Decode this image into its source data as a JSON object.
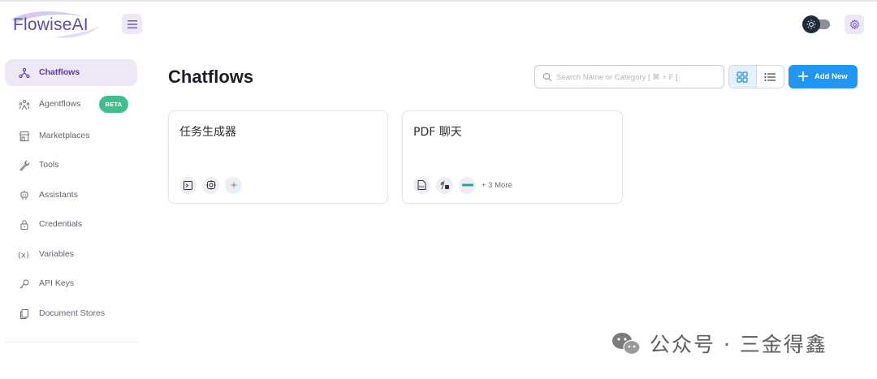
{
  "app": {
    "logo_text": "FlowiseAI"
  },
  "header": {
    "menu_icon": "menu-icon",
    "theme_icon": "sun-icon",
    "settings_icon": "gear-icon"
  },
  "sidebar": {
    "items": [
      {
        "label": "Chatflows",
        "icon": "chatflows-icon",
        "active": true
      },
      {
        "label": "Agentflows",
        "icon": "agentflows-icon",
        "badge": "BETA"
      },
      {
        "label": "Marketplaces",
        "icon": "store-icon"
      },
      {
        "label": "Tools",
        "icon": "tool-icon"
      },
      {
        "label": "Assistants",
        "icon": "robot-icon"
      },
      {
        "label": "Credentials",
        "icon": "lock-icon"
      },
      {
        "label": "Variables",
        "icon": "variable-icon"
      },
      {
        "label": "API Keys",
        "icon": "key-icon"
      },
      {
        "label": "Document Stores",
        "icon": "documents-icon"
      }
    ]
  },
  "main": {
    "title": "Chatflows",
    "search": {
      "placeholder": "Search Name or Category [ ⌘ + F ]",
      "value": ""
    },
    "add_button_label": "Add New",
    "cards": [
      {
        "title": "任务生成器",
        "node_icons": [
          "terminal-icon",
          "sparkle-chip-icon",
          "star-icon"
        ]
      },
      {
        "title": "PDF 聊天",
        "node_icons": [
          "pdf-icon",
          "ai-icon",
          "embedding-icon"
        ],
        "more": "+ 3 More"
      }
    ]
  },
  "watermark": {
    "text": "公众号 · 三金得鑫"
  },
  "colors": {
    "accent_purple": "#5e35b1",
    "primary_blue": "#2196f3",
    "beta_green": "#3fbf8f"
  }
}
